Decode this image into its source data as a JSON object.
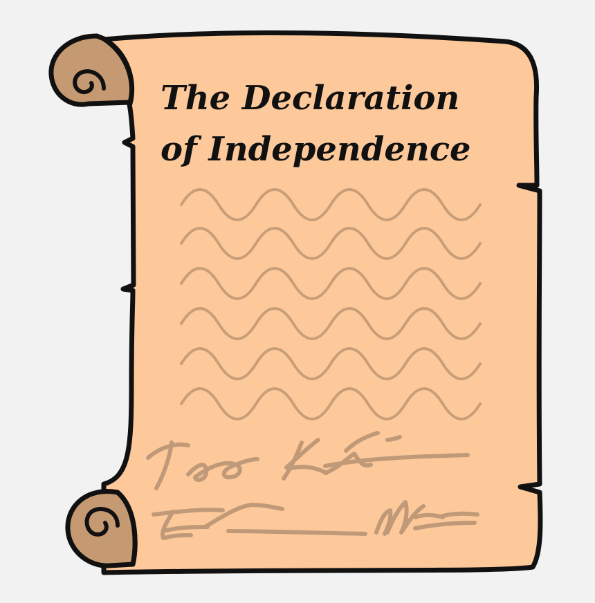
{
  "illustration": {
    "title_line_1": "The Declaration",
    "title_line_2": "of Independence",
    "colors": {
      "background": "#f2f2f2",
      "parchment": "#fdc99b",
      "roll": "#c59a72",
      "outline": "#111111",
      "text_squiggle": "#c89e78",
      "signature": "#c09a78"
    }
  }
}
